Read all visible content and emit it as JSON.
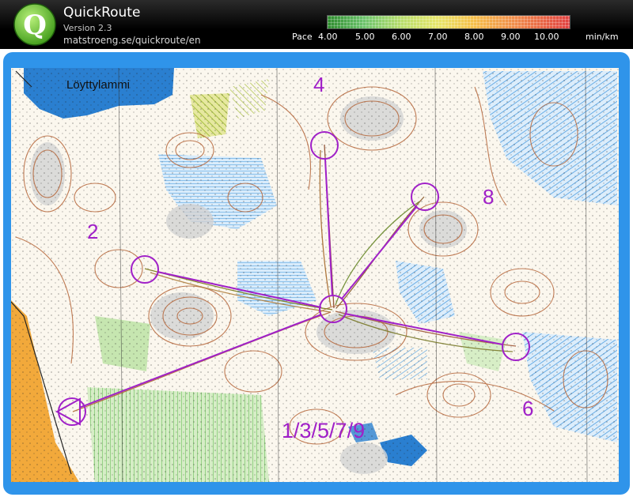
{
  "app": {
    "title": "QuickRoute",
    "version": "Version 2.3",
    "url": "matstroeng.se/quickroute/en",
    "logo_letter": "Q"
  },
  "pace_scale": {
    "label": "Pace",
    "ticks": [
      "4.00",
      "5.00",
      "6.00",
      "7.00",
      "8.00",
      "9.00",
      "10.00"
    ],
    "unit": "min/km"
  },
  "map": {
    "lake_name": "Löyttylammi",
    "control_labels": {
      "c2": "2",
      "c4": "4",
      "c6": "6",
      "c8": "8",
      "start_group": "1/3/5/7/9"
    }
  },
  "colors": {
    "frame_blue": "#2f94ea",
    "course_purple": "#a020c8",
    "contour_brown": "#b5663a",
    "water_blue": "#2a7fd0",
    "marsh_blue": "#4aa0e0",
    "open_yellow": "#f2a93b",
    "vegetation_green": "#9fd28a"
  }
}
